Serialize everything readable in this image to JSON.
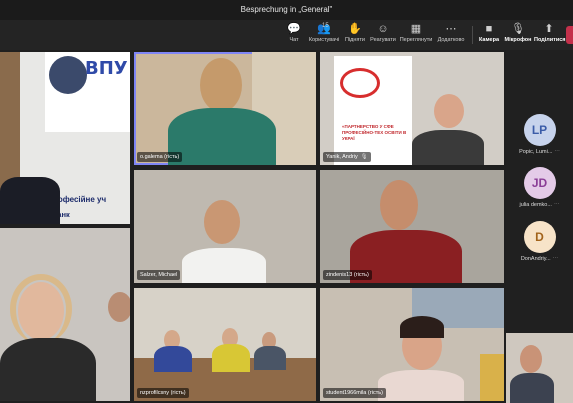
{
  "title": "Besprechung in „General\"",
  "toolbar": {
    "chat": {
      "label": "Чат",
      "icon": "chat-icon"
    },
    "people": {
      "label": "Користувачі",
      "icon": "people-icon",
      "count": "15"
    },
    "raise": {
      "label": "Підняти",
      "icon": "hand-icon"
    },
    "react": {
      "label": "Реагувати",
      "icon": "smile-icon"
    },
    "rooms": {
      "label": "Переглянути",
      "icon": "grid-icon"
    },
    "more": {
      "label": "Додатково",
      "icon": "more-icon"
    },
    "camera": {
      "label": "Камера",
      "icon": "camera-icon"
    },
    "mic": {
      "label": "Мікрофон",
      "icon": "mic-off-icon"
    },
    "share": {
      "label": "Поділитися",
      "icon": "share-icon"
    }
  },
  "tiles": [
    {
      "id": "t1",
      "name": ""
    },
    {
      "id": "t2",
      "name": "o.galema (гість)"
    },
    {
      "id": "t3",
      "name": "Yanik, Andriy"
    },
    {
      "id": "t4",
      "name": ""
    },
    {
      "id": "t5",
      "name": "Salzer, Michael"
    },
    {
      "id": "t6",
      "name": "zindenis13 (гість)"
    },
    {
      "id": "t7",
      "name": ""
    },
    {
      "id": "t8",
      "name": "nzprofilcsny (гість)"
    },
    {
      "id": "t9",
      "name": "student1966mila (гість)"
    }
  ],
  "banner": {
    "vpu": "ВПУ",
    "school": "Вище професійне уч",
    "city": "вано-Франк",
    "partner": "«ПАРТНЕРСТВО У СФЕ ПРОФЕСІЙНО-ТЕХ ОСВІТИ В УКРАЇ"
  },
  "roster": [
    {
      "initials": "LP",
      "name": "Popic, Lumi...",
      "suffix": "⋯",
      "color": "#c7d3ec",
      "text": "#3b5ca8"
    },
    {
      "initials": "JD",
      "name": "julia demko...",
      "suffix": "⋯",
      "color": "#e4cbe8",
      "text": "#8a3d96"
    },
    {
      "initials": "D",
      "name": "DonAndriy...",
      "suffix": "⋯",
      "color": "#f7e3c8",
      "text": "#a2631b"
    }
  ]
}
